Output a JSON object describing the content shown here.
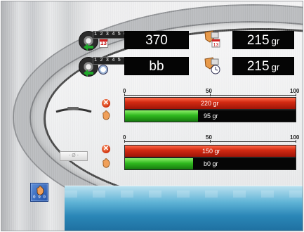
{
  "counters": {
    "top_digits": "1 2 3 4 5 6",
    "bottom_digits": "1 2 3 4 5 7",
    "calendar_number": "13"
  },
  "row1": {
    "value": "370",
    "weight_value": "215",
    "weight_unit": "gr"
  },
  "row2": {
    "value": "bb",
    "weight_value": "215",
    "weight_unit": "gr"
  },
  "chart1": {
    "scale": [
      "0",
      "50",
      "100"
    ],
    "red": {
      "label": "220 gr",
      "fraction": 1.0
    },
    "green": {
      "label": "95 gr",
      "fraction": 0.43
    }
  },
  "chart2": {
    "scale": [
      "0",
      "50",
      "100"
    ],
    "red": {
      "label": "150 gr",
      "fraction": 1.0
    },
    "green": {
      "label": "b0 gr",
      "fraction": 0.4
    }
  },
  "plate_text": "- Ø -",
  "corner_button_digits": "0 9 0",
  "colors": {
    "bar_red": "#c8240f",
    "bar_green": "#2fb81e",
    "value_box": "#050505",
    "water": "#2a86b7"
  }
}
